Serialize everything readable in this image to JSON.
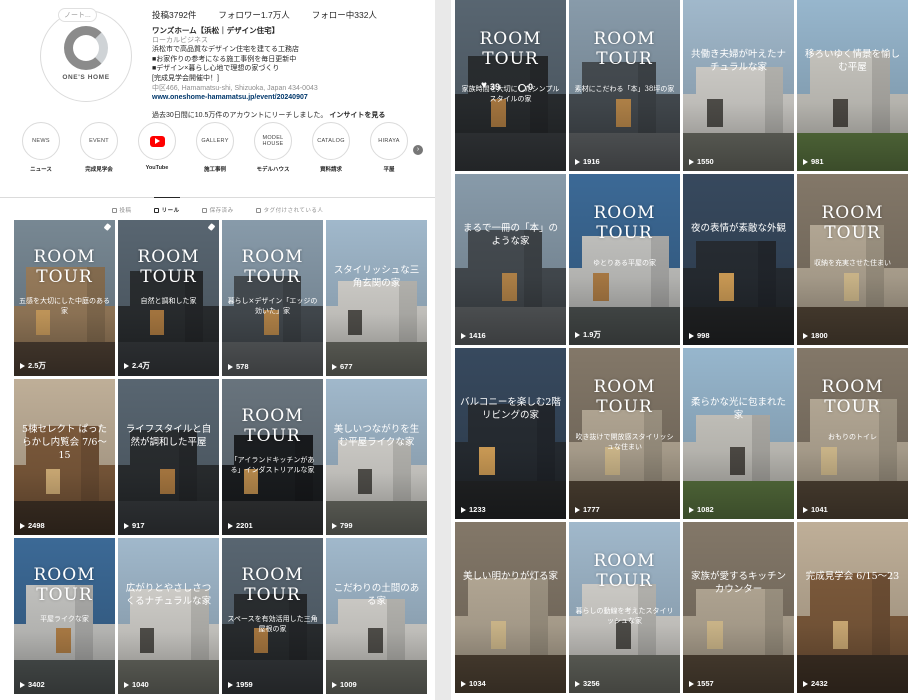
{
  "profile": {
    "note": "ノート...",
    "logo_text": "ONE'S HOME",
    "stats": {
      "posts": "投稿3792件",
      "followers": "フォロワー1.7万人",
      "following": "フォロー中332人"
    },
    "name": "ワンズホーム【浜松｜デザイン住宅】",
    "category": "ローカルビジネス",
    "bio_lines": [
      "浜松市で高品質なデザイン住宅を建てる工務店",
      "■お家作りの参考になる施工事例を毎日更新中",
      "■デザイン×暮らし心地で理想の家づくり",
      "[完成見学会開催中！]"
    ],
    "address": "中区466, Hamamatsu-shi, Shizuoka, Japan 434-0043",
    "link": "www.oneshome-hamamatsu.jp/event/20240907",
    "reach_text": "過去30日間に10.5万件のアカウントにリーチしました。",
    "insight_link": "インサイトを見る"
  },
  "highlights": [
    {
      "circle": "NEWS",
      "label": "ニュース"
    },
    {
      "circle": "EVENT",
      "label": "完成見学会"
    },
    {
      "circle": "",
      "label": "YouTube",
      "icon": "youtube-icon"
    },
    {
      "circle": "GALLERY",
      "label": "施工事例"
    },
    {
      "circle": "MODEL HOUSE",
      "label": "モデルハウス"
    },
    {
      "circle": "CATALOG",
      "label": "資料請求"
    },
    {
      "circle": "HIRAYA",
      "label": "平屋"
    }
  ],
  "tabs": [
    {
      "label": "投稿",
      "active": false
    },
    {
      "label": "リール",
      "active": true
    },
    {
      "label": "保存済み",
      "active": false
    },
    {
      "label": "タグ付けされている人",
      "active": false
    }
  ],
  "left_tiles": [
    {
      "title": "ROOM TOUR",
      "sub": "五感を大切にした中庭のある家",
      "views": "2.5万",
      "pinned": true,
      "palette": "warm"
    },
    {
      "title": "ROOM TOUR",
      "sub": "自然と調和した家",
      "views": "2.4万",
      "pinned": true,
      "palette": "dark"
    },
    {
      "title": "ROOM TOUR",
      "sub": "暮らし×デザイン「エッジの効いた」家",
      "views": "578",
      "pinned": false,
      "palette": "gray"
    },
    {
      "title": "",
      "sub": "スタイリッシュな三角玄関の家",
      "views": "677",
      "pinned": false,
      "palette": "white"
    },
    {
      "title": "",
      "sub": "5棟セレクト ぱったらかし内覧会 7/6〜15",
      "views": "2498",
      "pinned": false,
      "palette": "wood"
    },
    {
      "title": "",
      "sub": "ライフスタイルと自然が調和した平屋",
      "views": "917",
      "pinned": false,
      "palette": "dark"
    },
    {
      "title": "ROOM TOUR",
      "sub": "「アイランドキッチンがある」インダストリアルな家",
      "views": "2201",
      "pinned": false,
      "palette": "black"
    },
    {
      "title": "",
      "sub": "美しいつながりを生む平屋ライクな家",
      "views": "799",
      "pinned": false,
      "palette": "white"
    },
    {
      "title": "ROOM TOUR",
      "sub": "平屋ライクな家",
      "views": "3402",
      "pinned": false,
      "palette": "blue"
    },
    {
      "title": "",
      "sub": "広がりとやさしさつくるナチュラルな家",
      "views": "1040",
      "pinned": false,
      "palette": "white"
    },
    {
      "title": "ROOM TOUR",
      "sub": "スペースを有効活用した三角屋根の家",
      "views": "1959",
      "pinned": false,
      "palette": "dark"
    },
    {
      "title": "",
      "sub": "こだわりの土間のある家",
      "views": "1009",
      "pinned": false,
      "palette": "white"
    }
  ],
  "right_tiles": [
    {
      "title": "ROOM TOUR",
      "sub": "家族時間を大切にしたシンプルスタイルの家",
      "views": "",
      "likes": "39",
      "comments": "0",
      "palette": "dark"
    },
    {
      "title": "ROOM TOUR",
      "sub": "素材にこだわる「本」38坪の家",
      "views": "1916",
      "palette": "gray"
    },
    {
      "title": "",
      "sub": "共働き夫婦が叶えたナチュラルな家",
      "views": "1550",
      "palette": "white"
    },
    {
      "title": "",
      "sub": "移ろいゆく情景を愉しむ平屋",
      "views": "981",
      "palette": "green"
    },
    {
      "title": "",
      "sub": "まるで一冊の「本」のような家",
      "views": "1416",
      "palette": "gray"
    },
    {
      "title": "ROOM TOUR",
      "sub": "ゆとりある平屋の家",
      "views": "1.9万",
      "palette": "blue"
    },
    {
      "title": "",
      "sub": "夜の表情が素敵な外観",
      "views": "998",
      "palette": "dusk"
    },
    {
      "title": "ROOM TOUR",
      "sub": "収納を充実させた住まい",
      "views": "1800",
      "palette": "interior"
    },
    {
      "title": "",
      "sub": "バルコニーを楽しむ2階リビングの家",
      "views": "1233",
      "palette": "dusk"
    },
    {
      "title": "ROOM TOUR",
      "sub": "吹き抜けで開放感スタイリッシュな住まい",
      "views": "1777",
      "palette": "interior"
    },
    {
      "title": "",
      "sub": "柔らかな光に包まれた家",
      "views": "1082",
      "palette": "green"
    },
    {
      "title": "ROOM TOUR",
      "sub": "おもりのトイレ",
      "views": "1041",
      "palette": "interior"
    },
    {
      "title": "",
      "sub": "美しい明かりが灯る家",
      "views": "1034",
      "palette": "interior"
    },
    {
      "title": "ROOM TOUR",
      "sub": "暮らしの動線を考えたスタイリッシュな家",
      "views": "3256",
      "palette": "white"
    },
    {
      "title": "",
      "sub": "家族が愛するキッチンカウンター",
      "views": "1557",
      "palette": "interior"
    },
    {
      "title": "",
      "sub": "完成見学会 6/15〜23",
      "views": "2432",
      "palette": "wood"
    }
  ]
}
